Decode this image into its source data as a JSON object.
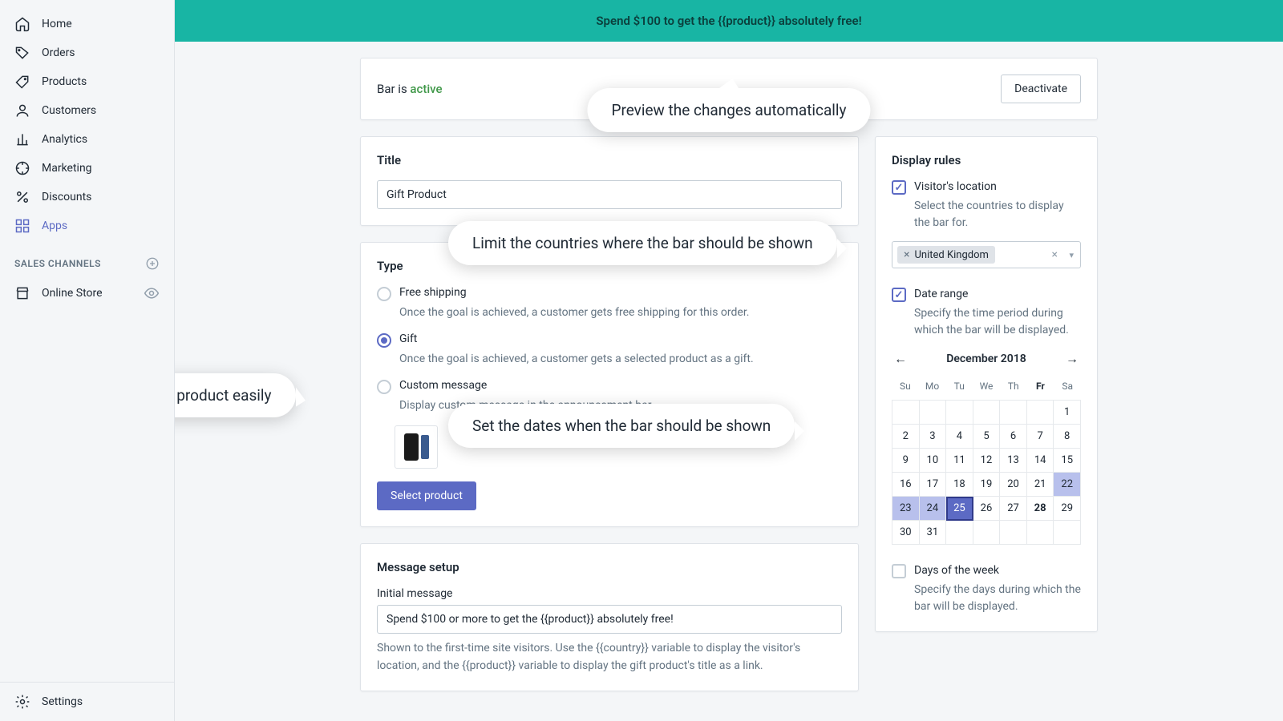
{
  "sidebar": {
    "items": [
      {
        "label": "Home"
      },
      {
        "label": "Orders"
      },
      {
        "label": "Products"
      },
      {
        "label": "Customers"
      },
      {
        "label": "Analytics"
      },
      {
        "label": "Marketing"
      },
      {
        "label": "Discounts"
      },
      {
        "label": "Apps"
      }
    ],
    "channels_heading": "SALES CHANNELS",
    "channel": "Online Store",
    "settings": "Settings"
  },
  "banner": "Spend $100 to get the {{product}} absolutely free!",
  "status": {
    "prefix": "Bar is ",
    "state": "active",
    "deactivate": "Deactivate"
  },
  "callouts": {
    "preview": "Preview the changes automatically",
    "countries": "Limit the countries where the bar should be shown",
    "dates": "Set the dates when the bar should be shown",
    "gift": "Select the gift product easily"
  },
  "title": {
    "label": "Title",
    "value": "Gift Product"
  },
  "type": {
    "label": "Type",
    "free": {
      "label": "Free shipping",
      "help": "Once the goal is achieved, a customer gets free shipping for this order."
    },
    "gift": {
      "label": "Gift",
      "help": "Once the goal is achieved, a customer gets a selected product as a gift."
    },
    "custom": {
      "label": "Custom message",
      "help": "Display custom message in the announcement bar."
    },
    "select_btn": "Select product"
  },
  "message": {
    "label": "Message setup",
    "initial_label": "Initial message",
    "initial_value": "Spend $100 or more to get the {{product}} absolutely free!",
    "help": "Shown to the first-time site visitors. Use the {{country}} variable to display the visitor's location, and the {{product}} variable to display the gift product's title as a link."
  },
  "rules": {
    "label": "Display rules",
    "location": {
      "label": "Visitor's location",
      "help": "Select the countries to display the bar for.",
      "country": "United Kingdom"
    },
    "date": {
      "label": "Date range",
      "help": "Specify the time period during which the bar will be displayed."
    },
    "days": {
      "label": "Days of the week",
      "help": "Specify the days during which the bar will be displayed."
    }
  },
  "calendar": {
    "month": "December 2018",
    "dow": [
      "Su",
      "Mo",
      "Tu",
      "We",
      "Th",
      "Fr",
      "Sa"
    ],
    "lead_empty": 6,
    "days_in_month": 31,
    "selected": [
      22,
      23,
      24,
      25
    ],
    "current": 25,
    "bold": [
      28
    ]
  }
}
